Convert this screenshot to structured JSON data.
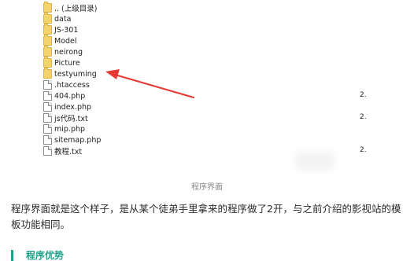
{
  "file_list": [
    {
      "name": ".. (上级目录)",
      "type": "folder",
      "size": ""
    },
    {
      "name": "data",
      "type": "folder",
      "size": ""
    },
    {
      "name": "JS-301",
      "type": "folder",
      "size": ""
    },
    {
      "name": "Model",
      "type": "folder",
      "size": ""
    },
    {
      "name": "neirong",
      "type": "folder",
      "size": ""
    },
    {
      "name": "Picture",
      "type": "folder",
      "size": ""
    },
    {
      "name": "testyuming",
      "type": "folder",
      "size": ""
    },
    {
      "name": ".htaccess",
      "type": "file",
      "size": ""
    },
    {
      "name": "404.php",
      "type": "file",
      "size": "2."
    },
    {
      "name": "index.php",
      "type": "file",
      "size": ""
    },
    {
      "name": "js代码.txt",
      "type": "file",
      "size": "2."
    },
    {
      "name": "mip.php",
      "type": "file",
      "size": ""
    },
    {
      "name": "sitemap.php",
      "type": "file",
      "size": ""
    },
    {
      "name": "教程.txt",
      "type": "file",
      "size": "2."
    }
  ],
  "arrow_color": "#e53935",
  "caption": "程序界面",
  "paragraph": "程序界面就是这个样子，是从某个徒弟手里拿来的程序做了2开，与之前介绍的影视站的模板功能相同。",
  "heading": "程序优势",
  "accent_color": "#1aa38a"
}
